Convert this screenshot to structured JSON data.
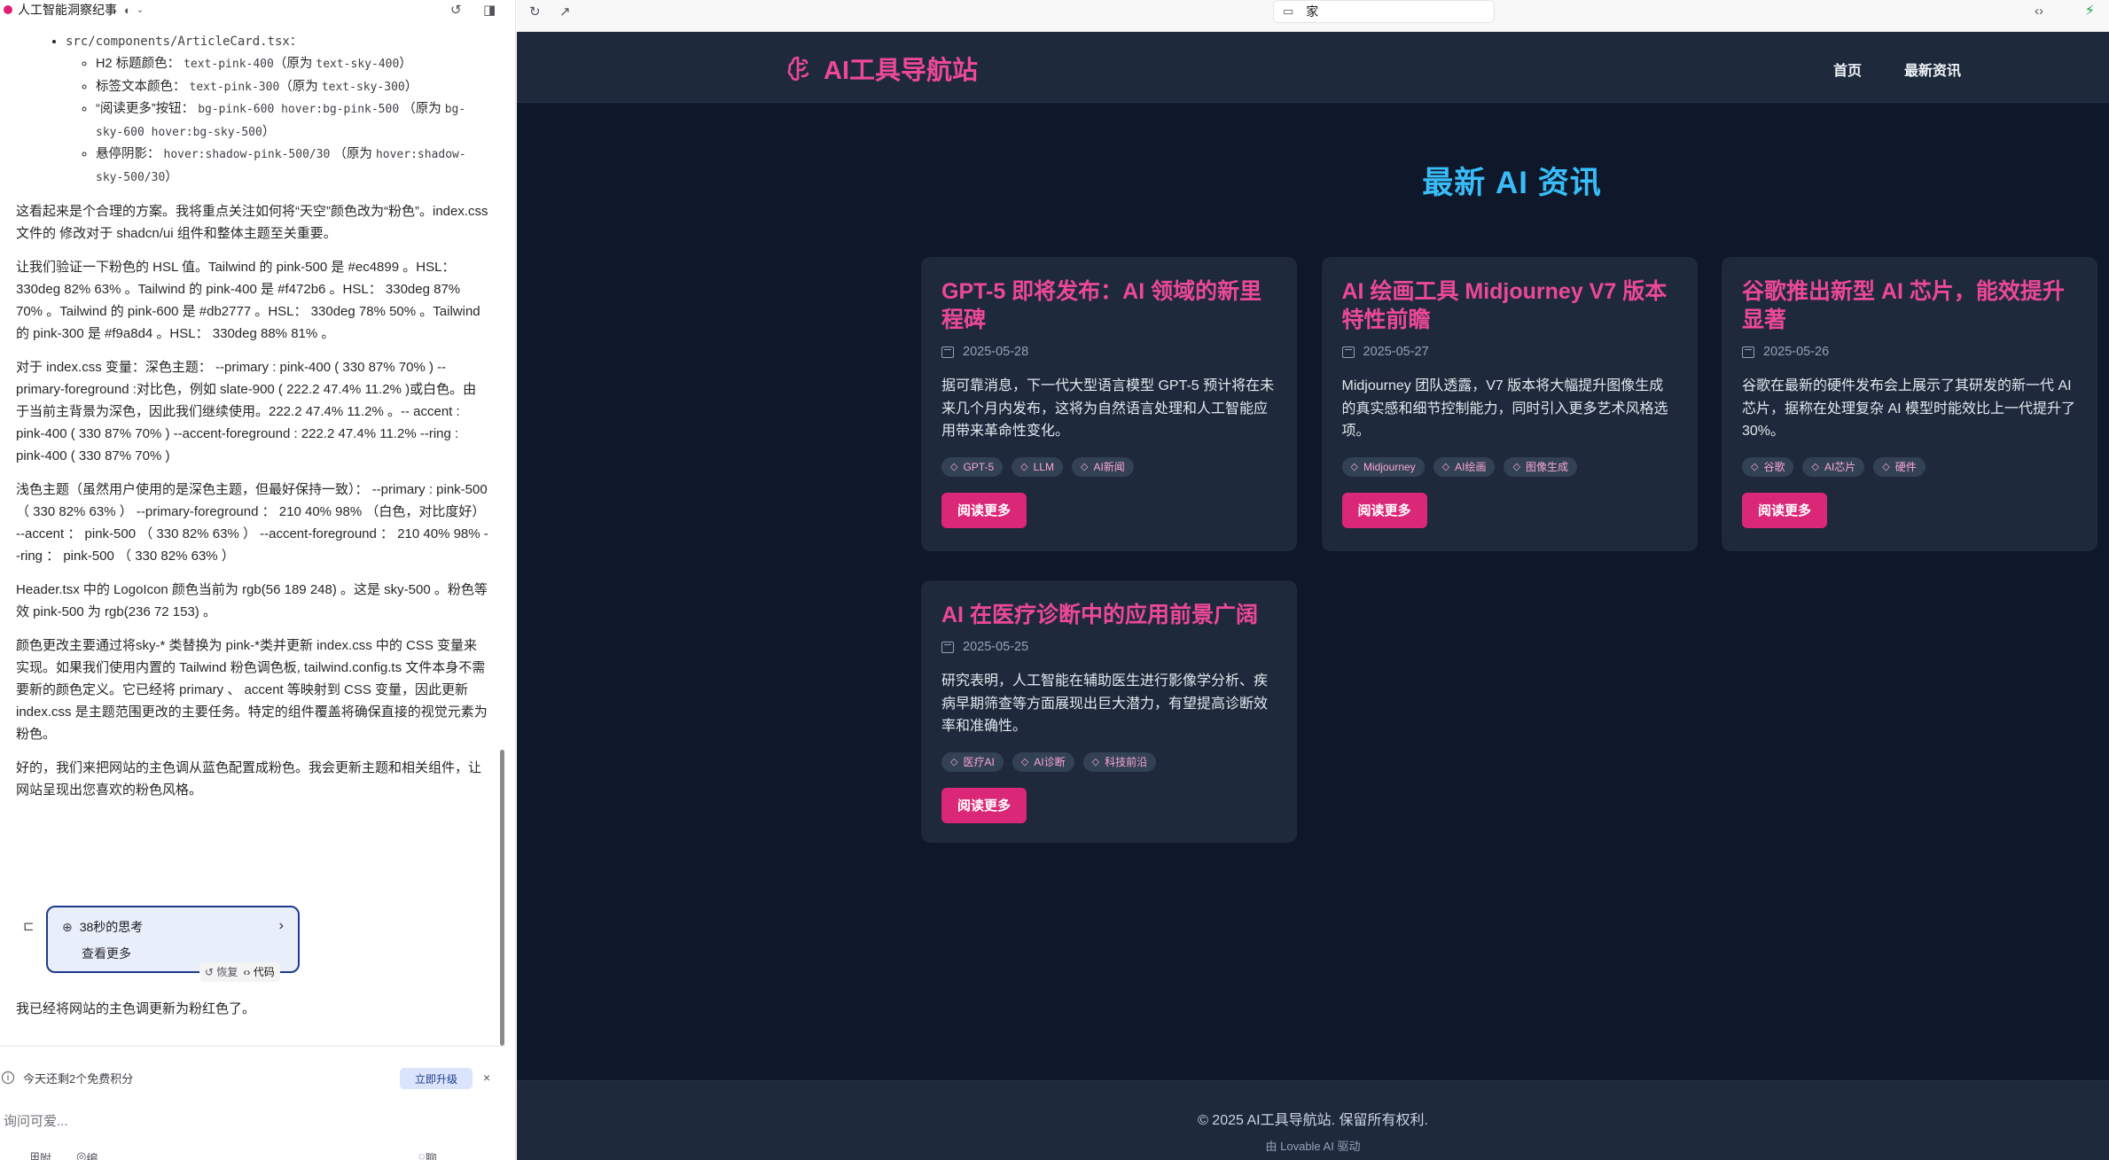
{
  "left_panel": {
    "project_title": "人工智能洞察纪事",
    "chat": {
      "file_path": "src/components/ArticleCard.tsx：",
      "changes": [
        {
          "prefix": "H2 标题颜色： ",
          "new": "text-pink-400",
          "orig_open": "（原为 ",
          "old": "text-sky-400",
          "orig_close": "）"
        },
        {
          "prefix": "标签文本颜色： ",
          "new": "text-pink-300",
          "orig_open": "（原为 ",
          "old": "text-sky-300",
          "orig_close": "）"
        },
        {
          "prefix": "“阅读更多”按钮： ",
          "new": "bg-pink-600 hover:bg-pink-500",
          "orig_open": " （原为 ",
          "old": "bg-sky-600 hover:bg-sky-500",
          "orig_close": "）"
        },
        {
          "prefix": "悬停阴影： ",
          "new": "hover:shadow-pink-500/30",
          "orig_open": " （原为 ",
          "old": "hover:shadow-sky-500/30",
          "orig_close": "）"
        }
      ],
      "paragraphs": [
        "这看起来是个合理的方案。我将重点关注如何将“天空”颜色改为“粉色”。index.css 文件的 修改对于 shadcn/ui 组件和整体主题至关重要。",
        "让我们验证一下粉色的 HSL 值。Tailwind 的 pink-500 是 #ec4899 。HSL： 330deg 82% 63% 。Tailwind 的 pink-400 是 #f472b6 。HSL： 330deg 87% 70% 。Tailwind 的 pink-600 是 #db2777 。HSL： 330deg 78% 50% 。Tailwind 的 pink-300 是 #f9a8d4 。HSL： 330deg 88% 81% 。",
        "对于 index.css 变量：深色主题： --primary : pink-400 ( 330 87% 70% ) --primary-foreground :对比色，例如 slate-900 ( 222.2 47.4% 11.2% )或白色。由于当前主背景为深色，因此我们继续使用。222.2 47.4% 11.2% 。-- accent : pink-400 ( 330 87% 70% ) --accent-foreground : 222.2 47.4% 11.2%  --ring : pink-400 ( 330 87% 70% )",
        "浅色主题（虽然用户使用的是深色主题，但最好保持一致）： --primary : pink-500 （ 330 82% 63% ） --primary-foreground ： 210 40% 98% （白色，对比度好） --accent ： pink-500 （ 330 82% 63% ） --accent-foreground ： 210 40% 98%  --ring ： pink-500 （ 330 82% 63% ）",
        "Header.tsx 中的 LogoIcon 颜色当前为 rgb(56 189 248) 。这是 sky-500 。粉色等效 pink-500 为 rgb(236 72 153) 。",
        "颜色更改主要通过将sky-* 类替换为 pink-*类并更新 index.css 中的 CSS 变量来实现。如果我们使用内置的 Tailwind 粉色调色板, tailwind.config.ts 文件本身不需要新的颜色定义。它已经将 primary 、 accent 等映射到 CSS 变量，因此更新 index.css 是主题范围更改的主要任务。特定的组件覆盖将确保直接的视觉元素为粉色。",
        "好的，我们来把网站的主色调从蓝色配置成粉色。我会更新主题和相关组件，让网站呈现出您喜欢的粉色风格。"
      ],
      "thinking": {
        "label": "38秒的思考",
        "more": "查看更多"
      },
      "actions": {
        "restore": "恢复",
        "code": "代码"
      },
      "final_message": "我已经将网站的主色调更新为粉红色了。"
    },
    "credits": {
      "text": "今天还剩2个免费积分",
      "upgrade": "立即升级"
    },
    "input": {
      "placeholder": "询问可爱..."
    },
    "input_tools": {
      "attach": "附",
      "edit": "编辑",
      "chat": "聊天"
    }
  },
  "browser": {
    "address": "家"
  },
  "site": {
    "brand": "AI工具导航站",
    "nav": [
      "首页",
      "最新资讯"
    ],
    "heading": "最新 AI 资讯",
    "articles": [
      {
        "title": "GPT-5 即将发布：AI 领域的新里程碑",
        "date": "2025-05-28",
        "excerpt": "据可靠消息，下一代大型语言模型 GPT-5 预计将在未来几个月内发布，这将为自然语言处理和人工智能应用带来革命性变化。",
        "tags": [
          "GPT-5",
          "LLM",
          "AI新闻"
        ],
        "button": "阅读更多"
      },
      {
        "title": "AI 绘画工具 Midjourney V7 版本特性前瞻",
        "date": "2025-05-27",
        "excerpt": "Midjourney 团队透露，V7 版本将大幅提升图像生成的真实感和细节控制能力，同时引入更多艺术风格选项。",
        "tags": [
          "Midjourney",
          "AI绘画",
          "图像生成"
        ],
        "button": "阅读更多"
      },
      {
        "title": "谷歌推出新型 AI 芯片，能效提升显著",
        "date": "2025-05-26",
        "excerpt": "谷歌在最新的硬件发布会上展示了其研发的新一代 AI 芯片，据称在处理复杂 AI 模型时能效比上一代提升了 30%。",
        "tags": [
          "谷歌",
          "AI芯片",
          "硬件"
        ],
        "button": "阅读更多"
      },
      {
        "title": "AI 在医疗诊断中的应用前景广阔",
        "date": "2025-05-25",
        "excerpt": "研究表明，人工智能在辅助医生进行影像学分析、疾病早期筛查等方面展现出巨大潜力，有望提高诊断效率和准确性。",
        "tags": [
          "医疗AI",
          "AI诊断",
          "科技前沿"
        ],
        "button": "阅读更多"
      }
    ],
    "footer": {
      "copyright": "© 2025 AI工具导航站. 保留所有权利.",
      "powered": "由 Lovable AI 驱动"
    }
  },
  "colors": {
    "brand_pink": "#ec4899",
    "button_pink": "#db2777",
    "heading_sky": "#38bdf8",
    "site_bg": "#0f172a",
    "card_bg": "#1e293b"
  }
}
